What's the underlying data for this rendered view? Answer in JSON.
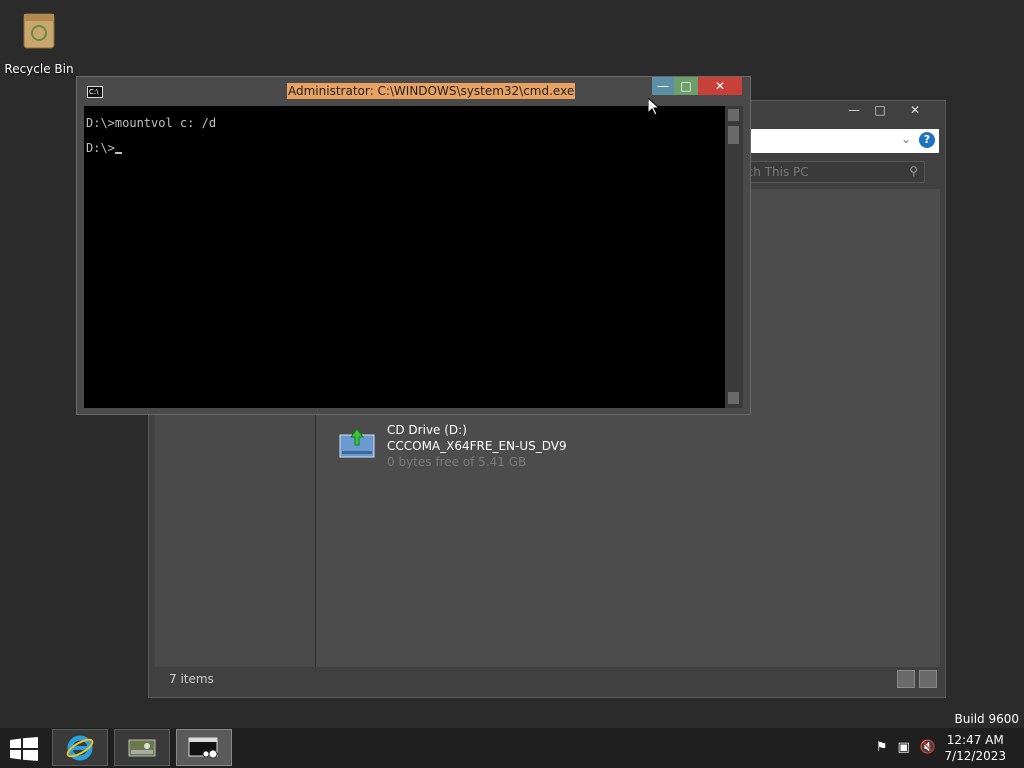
{
  "desktop": {
    "recycle_bin_label": "Recycle Bin",
    "build_text": "Build 9600"
  },
  "explorer": {
    "search_placeholder": "rch This PC",
    "drive": {
      "name": "CD Drive (D:)",
      "label": "CCCOMA_X64FRE_EN-US_DV9",
      "free": "0 bytes free of 5.41 GB"
    },
    "status_items": "7 items",
    "help_glyph": "?"
  },
  "cmd": {
    "title": "Administrator: C:\\WINDOWS\\system32\\cmd.exe",
    "icon_text": "C:\\",
    "lines": [
      "D:\\>mountvol c: /d",
      "D:\\>"
    ]
  },
  "taskbar": {
    "time": "12:47 AM",
    "date": "7/12/2023",
    "buttons": [
      "internet-explorer",
      "server-manager",
      "command-prompt"
    ]
  },
  "colors": {
    "title_highlight": "#e9a262",
    "close_red": "#c8403a",
    "accent_blue": "#1e73be"
  }
}
